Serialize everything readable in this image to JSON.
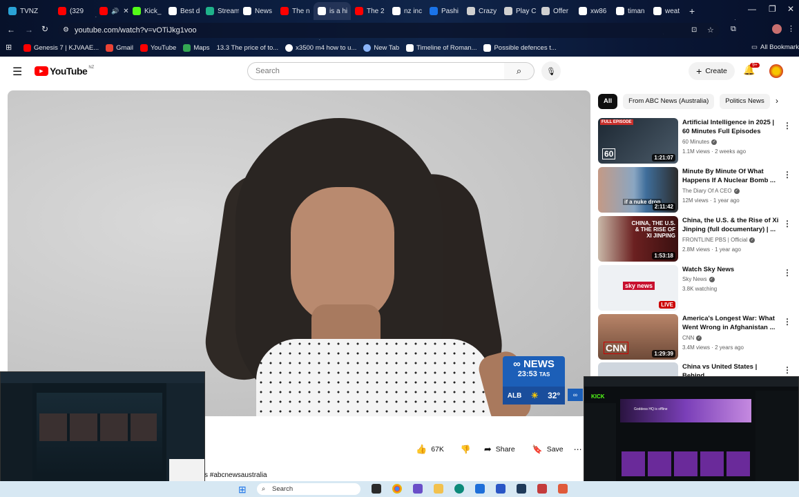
{
  "browser": {
    "tabs": [
      {
        "label": "TVNZ",
        "color": "#2aa3d6"
      },
      {
        "label": "(329",
        "color": "#ff0000"
      },
      {
        "label": "",
        "color": "#ff0000"
      },
      {
        "label": "Kick_",
        "color": "#53fc18"
      },
      {
        "label": "Best d",
        "color": "#ffffff"
      },
      {
        "label": "Stream",
        "color": "#1fb28a"
      },
      {
        "label": "News",
        "color": "#ffffff"
      },
      {
        "label": "The n",
        "color": "#ff0000"
      },
      {
        "label": "is a hi",
        "color": "#ffffff"
      },
      {
        "label": "The 2",
        "color": "#ff0000"
      },
      {
        "label": "nz inc",
        "color": "#ffffff"
      },
      {
        "label": "Pashi",
        "color": "#1a73e8"
      },
      {
        "label": "Crazy",
        "color": "#d0d0d0"
      },
      {
        "label": "Play C",
        "color": "#d0d0d0"
      },
      {
        "label": "Offer",
        "color": "#d0d0d0"
      },
      {
        "label": "xw86",
        "color": "#ffffff"
      },
      {
        "label": "timan",
        "color": "#ffffff"
      },
      {
        "label": "weat",
        "color": "#ffffff"
      }
    ],
    "new_tab_icon": "+",
    "url": "youtube.com/watch?v=vOTiJkg1voo",
    "bookmarks": [
      {
        "label": "Genesis 7 | KJVAAE...",
        "color": "#ff0000"
      },
      {
        "label": "Gmail",
        "color": "#ea4335"
      },
      {
        "label": "YouTube",
        "color": "#ff0000"
      },
      {
        "label": "Maps",
        "color": "#34a853"
      },
      {
        "label": "13.3 The price of to...",
        "color": "#8ab4f8"
      },
      {
        "label": "x3500 m4 how to u...",
        "color": "#ffffff"
      },
      {
        "label": "New Tab",
        "color": "#8ab4f8"
      },
      {
        "label": "Timeline of Roman...",
        "color": "#ffffff"
      },
      {
        "label": "Possible defences t...",
        "color": "#ffffff"
      }
    ],
    "all_bookmarks_label": "All Bookmarks"
  },
  "youtube": {
    "logo_text": "YouTube",
    "region": "NZ",
    "search_placeholder": "Search",
    "create_label": "Create",
    "notif_count": "9+",
    "accent": "#ff0000"
  },
  "player": {
    "bug_brand": "NEWS",
    "bug_time": "23:53",
    "bug_tz": "TAS",
    "bug_city": "ALB",
    "bug_temp": "32°"
  },
  "actions": {
    "likes": "67K",
    "share_label": "Share",
    "save_label": "Save",
    "hashtag": "#abcnewsaustralia"
  },
  "chips": [
    "All",
    "From ABC News (Australia)",
    "Politics News"
  ],
  "recommendations": [
    {
      "title": "Artificial Intelligence in 2025 | 60 Minutes Full Episodes",
      "channel": "60 Minutes",
      "meta": "1.1M views · 2 weeks ago",
      "duration": "1:21:07",
      "thumb_color": "#2b3b4a",
      "badge": "FULL EPISODE"
    },
    {
      "title": "Minute By Minute Of What Happens If A Nuclear Bomb ...",
      "channel": "The Diary Of A CEO",
      "meta": "12M views · 1 year ago",
      "duration": "2:11:42",
      "thumb_color": "#5b7da3",
      "badge": "if a nuke drop"
    },
    {
      "title": "China, the U.S. & the Rise of Xi Jinping (full documentary) | ...",
      "channel": "FRONTLINE PBS | Official",
      "meta": "2.8M views · 1 year ago",
      "duration": "1:53:18",
      "thumb_color": "#6b2020",
      "badge": "CHINA, THE U.S. & THE RISE OF XI JINPING"
    },
    {
      "title": "Watch Sky News",
      "channel": "Sky News",
      "meta": "3.8K watching",
      "duration": "LIVE",
      "thumb_color": "#e9edf2",
      "badge": "sky news"
    },
    {
      "title": "America's Longest War: What Went Wrong in Afghanistan ...",
      "channel": "CNN",
      "meta": "3.4M views · 2 years ago",
      "duration": "1:29:39",
      "thumb_color": "#8a5a44",
      "badge": "CNN"
    },
    {
      "title": "China vs United States | Behind",
      "channel": "",
      "meta": "",
      "duration": "",
      "thumb_color": "#cfd6de",
      "badge": ""
    }
  ],
  "taskbar": {
    "search_label": "Search"
  },
  "overlay_right": {
    "brand": "KICK",
    "offline_text": "Goddess HQ is offline"
  }
}
